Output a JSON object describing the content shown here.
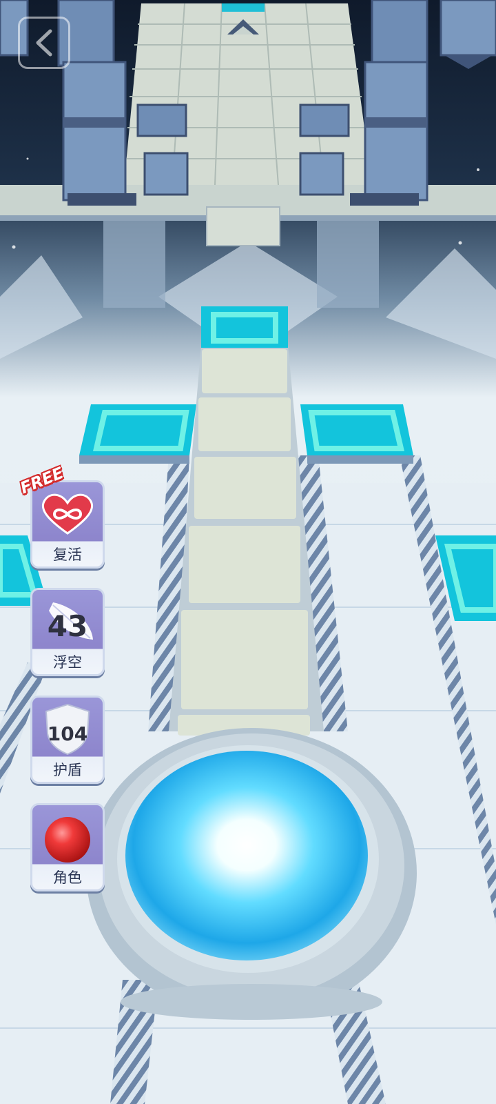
{
  "game": {
    "powerups": [
      {
        "id": "revive",
        "label": "复活",
        "badge": "FREE",
        "icon": "infinity-heart-icon",
        "count": ""
      },
      {
        "id": "float",
        "label": "浮空",
        "icon": "feather-icon",
        "count": "43"
      },
      {
        "id": "shield",
        "label": "护盾",
        "icon": "shield-icon",
        "count": "104"
      },
      {
        "id": "character",
        "label": "角色",
        "icon": "red-ball-icon",
        "count": ""
      }
    ],
    "colors": {
      "tile_cyan": "#19c6dd",
      "tile_cyan_light": "#6ff1e6",
      "path_stone": "#dde4d6",
      "pillar": "#6d8ab2",
      "free_badge": "#d42a2a",
      "powerup_bg": "#8d85cc",
      "ball": "#e02828"
    },
    "back_icon": "back-arrow-icon"
  }
}
